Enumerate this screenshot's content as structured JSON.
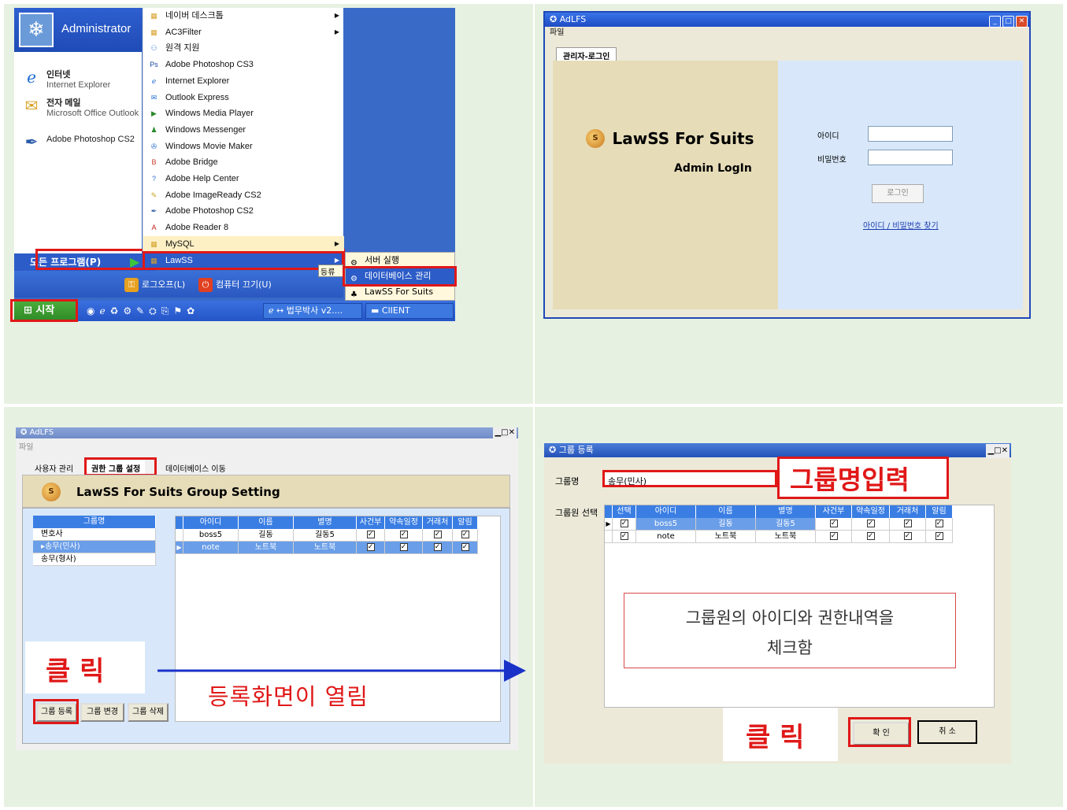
{
  "panel1": {
    "user": "Administrator",
    "pinned": [
      {
        "title": "인터넷",
        "sub": "Internet Explorer",
        "icon": "ie-icon"
      },
      {
        "title": "전자 메일",
        "sub": "Microsoft Office Outlook",
        "icon": "mail-icon"
      },
      {
        "title": "Adobe Photoshop CS2",
        "sub": "",
        "icon": "feather-icon"
      }
    ],
    "all_programs": "모든 프로그램(P)",
    "logoff": "로그오프(L)",
    "shutdown": "컴퓨터 끄기(U)",
    "start": "시작",
    "tasks": [
      "↔ 법무박사 v2....",
      "ClIENT"
    ],
    "programs": [
      "네이버 데스크톱",
      "AC3Filter",
      "원격 지원",
      "Adobe Photoshop CS3",
      "Internet Explorer",
      "Outlook Express",
      "Windows Media Player",
      "Windows Messenger",
      "Windows Movie Maker",
      "Adobe Bridge",
      "Adobe Help Center",
      "Adobe ImageReady CS2",
      "Adobe Photoshop CS2",
      "Adobe Reader 8",
      "MySQL",
      "LawSS"
    ],
    "tooltip": "등류",
    "submenu": [
      "서버 실행",
      "데이터베이스 관리",
      "LawSS For Suits"
    ]
  },
  "panel2": {
    "title": "AdLFS",
    "menu": "파일",
    "tab": "관리자-로그인",
    "brand": "LawSS For Suits",
    "subtitle": "Admin LogIn",
    "id_label": "아이디",
    "pw_label": "비밀번호",
    "login_btn": "로그인",
    "find_link": "아이디 / 비밀번호 찾기"
  },
  "panel3": {
    "title": "AdLFS",
    "menu": "파일",
    "tabs": [
      "사용자 관리",
      "권한 그룹 설정",
      "데이터베이스 이동"
    ],
    "heading": "LawSS For Suits Group Setting",
    "group_col": "그룹명",
    "groups": [
      "변호사",
      "송무(민사)",
      "송무(형사)"
    ],
    "cols": [
      "아이디",
      "이름",
      "별명",
      "사건부",
      "약속일정",
      "거래처",
      "알림"
    ],
    "rows": [
      {
        "id": "boss5",
        "name": "길동",
        "nick": "길동5"
      },
      {
        "id": "note",
        "name": "노트북",
        "nick": "노트북"
      }
    ],
    "buttons": [
      "그룹 등록",
      "그룹 변경",
      "그룹 삭제"
    ],
    "click": "클 릭",
    "opens": "등록화면이 열림"
  },
  "panel4": {
    "title": "그룹 등록",
    "group_label": "그룹명",
    "group_value": "송무(민사)",
    "input_callout": "그룹명입력",
    "member_label": "그룹원 선택",
    "cols": [
      "선택",
      "아이디",
      "이름",
      "별명",
      "사건부",
      "약속일정",
      "거래처",
      "알림"
    ],
    "rows": [
      {
        "id": "boss5",
        "name": "길동",
        "nick": "길동5"
      },
      {
        "id": "note",
        "name": "노트북",
        "nick": "노트북"
      }
    ],
    "note_line1": "그룹원의 아이디와 권한내역을",
    "note_line2": "체크함",
    "click": "클 릭",
    "ok": "확 인",
    "cancel": "취 소"
  }
}
